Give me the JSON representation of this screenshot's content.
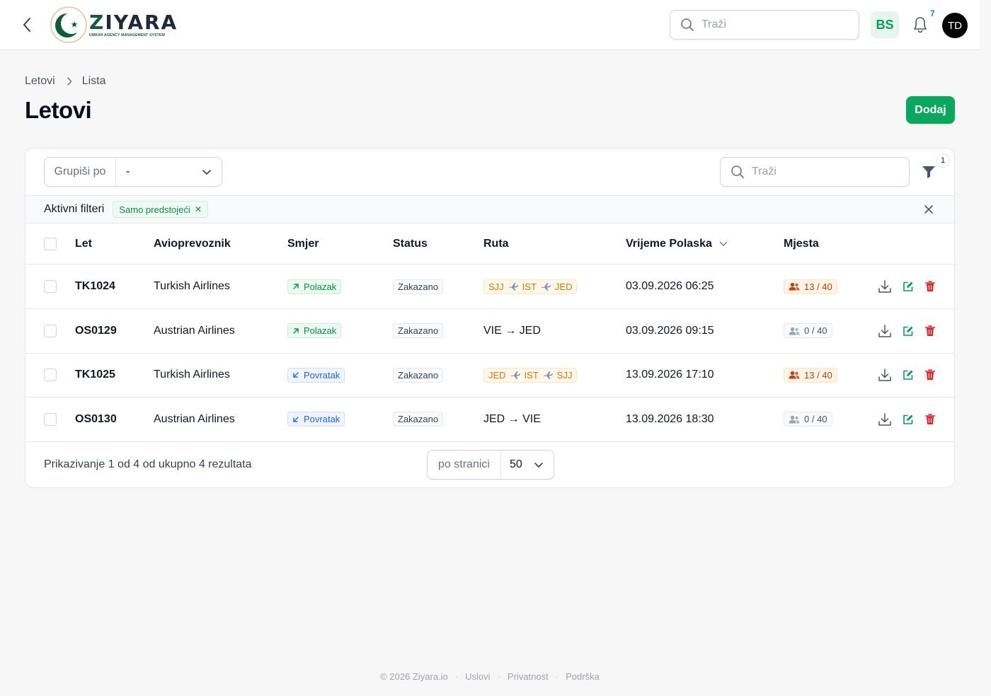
{
  "app": {
    "brand": "ZIYARA",
    "brand_prefix": "Z",
    "brand_rest": "IYARA",
    "tagline": "UMRAH AGENCY MANAGEMENT SYSTEM"
  },
  "topbar": {
    "search_placeholder": "Traži",
    "language": "BS",
    "notifications_count": "7",
    "user_initials": "TD"
  },
  "breadcrumb": [
    "Letovi",
    "Lista"
  ],
  "page_title": "Letovi",
  "add_button": "Dodaj",
  "toolbar": {
    "group_by_label": "Grupiši po",
    "group_by_value": "-",
    "search_placeholder": "Traži",
    "filter_count": "1"
  },
  "active_filters": {
    "label": "Aktivni filteri",
    "chips": [
      "Samo predstojeći"
    ]
  },
  "table": {
    "columns": [
      "Let",
      "Avioprevoznik",
      "Smjer",
      "Status",
      "Ruta",
      "Vrijeme Polaska",
      "Mjesta"
    ],
    "rows": [
      {
        "code": "TK1024",
        "airline": "Turkish Airlines",
        "direction": "Polazak",
        "direction_type": "out",
        "status": "Zakazano",
        "route": [
          "SJJ",
          "IST",
          "JED"
        ],
        "route_multi": true,
        "route_text": "",
        "departure": "03.09.2026 06:25",
        "seats": "13 / 40",
        "seats_full": true
      },
      {
        "code": "OS0129",
        "airline": "Austrian Airlines",
        "direction": "Polazak",
        "direction_type": "out",
        "status": "Zakazano",
        "route": [],
        "route_multi": false,
        "route_text": "VIE → JED",
        "departure": "03.09.2026 09:15",
        "seats": "0 / 40",
        "seats_full": false
      },
      {
        "code": "TK1025",
        "airline": "Turkish Airlines",
        "direction": "Povratak",
        "direction_type": "in",
        "status": "Zakazano",
        "route": [
          "JED",
          "IST",
          "SJJ"
        ],
        "route_multi": true,
        "route_text": "",
        "departure": "13.09.2026 17:10",
        "seats": "13 / 40",
        "seats_full": true
      },
      {
        "code": "OS0130",
        "airline": "Austrian Airlines",
        "direction": "Povratak",
        "direction_type": "in",
        "status": "Zakazano",
        "route": [],
        "route_multi": false,
        "route_text": "JED → VIE",
        "departure": "13.09.2026 18:30",
        "seats": "0 / 40",
        "seats_full": false
      }
    ]
  },
  "pagination": {
    "summary": "Prikazivanje 1 od 4 od ukupno 4 rezultata",
    "per_page_label": "po stranici",
    "per_page_value": "50"
  },
  "footer": {
    "copyright": "© 2026 Ziyara.io",
    "links": [
      "Uslovi",
      "Privatnost",
      "Podrška"
    ]
  },
  "colors": {
    "accent": "#0aa85f",
    "danger": "#dc2626",
    "brand_dark": "#0f5c3a"
  }
}
